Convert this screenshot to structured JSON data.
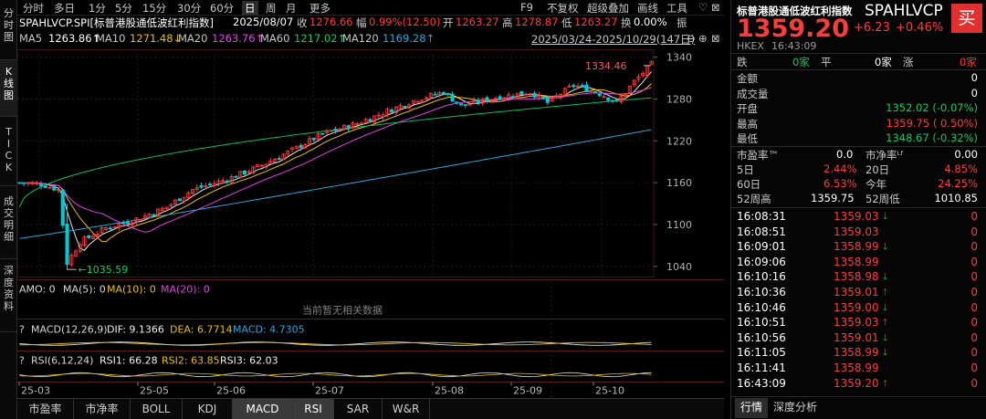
{
  "left_tabs": [
    "分时图",
    "K线图",
    "TICK",
    "成交明细",
    "深度资料"
  ],
  "top_toolbar": {
    "periods": [
      "分时",
      "多日",
      "1分",
      "5分",
      "15分",
      "30分",
      "60分",
      "日",
      "周",
      "月",
      "更多"
    ],
    "active_period": "日",
    "right": [
      "F9",
      "不复权",
      "超级叠加",
      "画线",
      "工具"
    ],
    "window_controls": [
      "♡",
      "⊠"
    ]
  },
  "quote_line": {
    "symbol": "SPAHLVCP.SPI[标普港股通低波红利指数]",
    "date": "2025/08/07",
    "close_label": "收",
    "close": "1276.66",
    "change_label": "幅",
    "change": "0.99%(12.50)",
    "open_label": "开",
    "open": "1263.27",
    "high_label": "高",
    "high": "1278.87",
    "low_label": "低",
    "low": "1263.27",
    "turnover_label": "换",
    "turnover": "0.00%",
    "amplitude_label": "振"
  },
  "ma_line": {
    "ma5_label": "MA5",
    "ma5": "1263.86↑",
    "ma10_label": "MA10",
    "ma10": "1271.48↓",
    "ma20_label": "MA20",
    "ma20": "1263.76↑",
    "ma60_label": "MA60",
    "ma60": "1217.02↑",
    "ma120_label": "MA120",
    "ma120": "1169.28↑",
    "range": "2025/03/24-2025/10/29(147日)",
    "range_controls": [
      "⊖",
      "⊕",
      "⊠"
    ]
  },
  "colors": {
    "up": "#ff3b3b",
    "down": "#00d060",
    "ma5": "#e8e8e8",
    "ma10": "#e8c000",
    "ma20": "#e040e0",
    "ma60": "#00c060",
    "ma120": "#2aa7d9",
    "grid": "#3a1a1a"
  },
  "main_chart": {
    "y_ticks": [
      "1340",
      "1280",
      "1220",
      "1160",
      "1100",
      "1040"
    ],
    "high_marker": "1334.46",
    "low_marker": "1035.59"
  },
  "amo_panel": {
    "text_amo": "AMO: 0",
    "text_ma5": "MA(5): 0",
    "text_ma10": "MA(10): 0",
    "text_ma20": "MA(20): 0",
    "empty_notice": "当前暂无相关数据"
  },
  "macd_panel": {
    "name": "MACD(12,26,9)",
    "dif": "DIF: 9.1366",
    "dea": "DEA: 6.7714",
    "macd": "MACD: 4.7305"
  },
  "rsi_panel": {
    "name": "RSI(6,12,24)",
    "rsi1": "RSI1: 66.28",
    "rsi2": "RSI2: 63.85",
    "rsi3": "RSI3: 62.03"
  },
  "x_axis": [
    "25-03",
    "25-05",
    "25-06",
    "25-07",
    "25-08",
    "25-09",
    "25-10"
  ],
  "bottom_tabs": [
    "市盈率",
    "市净率",
    "BOLL",
    "KDJ",
    "MACD",
    "RSI",
    "SAR",
    "W&R"
  ],
  "active_bottom_tabs": [
    "MACD",
    "RSI"
  ],
  "right": {
    "name": "标普港股通低波红利指数",
    "code": "SPAHLVCP",
    "buy_button": "买",
    "price": "1359.20",
    "change": "+6.23",
    "change_pct": "+0.46%",
    "market": "HKEX",
    "time": "16:43:09",
    "counts": {
      "fall_label": "跌",
      "fall": "0家",
      "flat_label": "平",
      "flat": "0家",
      "rise_label": "涨",
      "rise": "0家"
    },
    "stats": [
      {
        "label": "金额",
        "value": "0"
      },
      {
        "label": "成交量",
        "value": "0"
      },
      {
        "label": "开盘",
        "value": "1352.02 (-0.07%)"
      },
      {
        "label": "最高",
        "value": "1359.75 ( 0.50%)"
      },
      {
        "label": "最低",
        "value": "1348.67 (-0.32%)"
      }
    ],
    "ratios": [
      {
        "l1": "市盈率™",
        "v1": "0.0",
        "l2": "市净率ᴸᶠ",
        "v2": "0.00"
      },
      {
        "l1": "5日",
        "v1": "2.44%",
        "l2": "20日",
        "v2": "4.85%"
      },
      {
        "l1": "60日",
        "v1": "6.53%",
        "l2": "今年",
        "v2": "24.25%"
      },
      {
        "l1": "52周高",
        "v1": "1359.75",
        "l2": "52周低",
        "v2": "1010.85"
      }
    ],
    "ticks": [
      {
        "time": "16:08:31",
        "price": "1359.03",
        "dir": "down",
        "vol": "0"
      },
      {
        "time": "16:08:51",
        "price": "1359.03",
        "dir": "",
        "vol": "0"
      },
      {
        "time": "16:09:01",
        "price": "1358.99",
        "dir": "down",
        "vol": "0"
      },
      {
        "time": "16:09:06",
        "price": "1358.99",
        "dir": "",
        "vol": "0"
      },
      {
        "time": "16:10:16",
        "price": "1358.98",
        "dir": "down",
        "vol": "0"
      },
      {
        "time": "16:10:36",
        "price": "1359.01",
        "dir": "up",
        "vol": "0"
      },
      {
        "time": "16:10:46",
        "price": "1359.00",
        "dir": "down",
        "vol": "0"
      },
      {
        "time": "16:10:51",
        "price": "1359.03",
        "dir": "up",
        "vol": "0"
      },
      {
        "time": "16:10:56",
        "price": "1359.01",
        "dir": "down",
        "vol": "0"
      },
      {
        "time": "16:11:05",
        "price": "1358.99",
        "dir": "down",
        "vol": "0"
      },
      {
        "time": "16:11:41",
        "price": "1358.99",
        "dir": "",
        "vol": "0"
      },
      {
        "time": "16:43:09",
        "price": "1359.20",
        "dir": "up",
        "vol": "0"
      }
    ],
    "footer_tabs": [
      "行情",
      "深度分析"
    ]
  }
}
